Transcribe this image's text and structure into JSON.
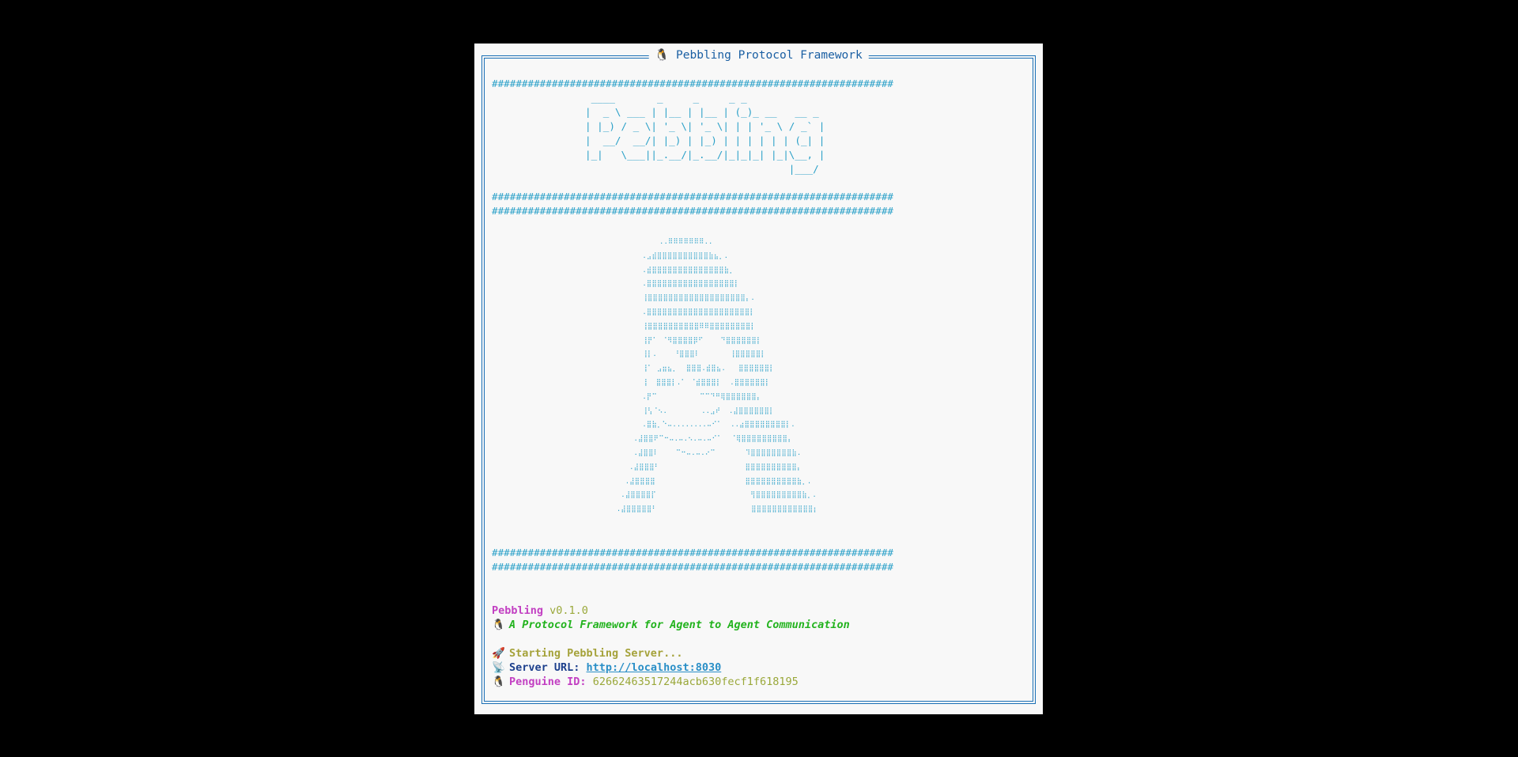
{
  "window": {
    "title": "🐧 Pebbling Protocol Framework"
  },
  "banner": {
    "hash_line": "###################################################################",
    "ascii_text": " ____       _     _     _ _\n|  _ \\ ___ | |__ | |__ | (_)_ __   __ _\n| |_) / _ \\| '_ \\| '_ \\| | | '_ \\ / _` |\n|  __/  __/| |_) | |_) | | | | | | (_| |\n|_|   \\___||_.__/|_.__/|_|_|_| |_|\\__, |\n                                  |___/"
  },
  "penguin": {
    "ascii_art": "          ..⠿⠿⠿⠿⠿⠿⠿..\n      .⣠⣾⣿⣿⣿⣿⣿⣿⣿⣿⣿⣿⣷⣦⡀.\n      .⣾⣿⣿⣿⣿⣿⣿⣿⣿⣿⣿⣿⣿⣿⣿⣷⡀\n      .⣿⣿⣿⣿⣿⣿⣿⣿⣿⣿⣿⣿⣿⣿⣿⣿⣿⡇\n      ⢸⣿⣿⣿⣿⣿⣿⣿⣿⣿⣿⣿⣿⣿⣿⣿⣿⣿⣿⣿⡄.\n      .⣿⣿⣿⣿⣿⣿⣿⣿⣿⣿⣿⣿⣿⣿⣿⣿⣿⣿⣿⣿⡇\n      ⢸⣿⣿⣿⣿⣿⣿⣿⣿⣿⣿⠿⠿⣿⣿⣿⣿⣿⣿⣿⣿⡇\n      ⢸⡟⠁ ⠈⠻⣿⣿⣿⣿⡿⠋    ⠙⣿⣿⣿⣿⣿⣿⡇\n      ⢸⡇.    ⠘⣿⣿⣿⠇       ⢸⣿⣿⣿⣿⣿⡇\n      ⢸⠁ ⣠⣶⣦⡀  ⣿⣿⣿.⣾⣿⣦.   ⣿⣿⣿⣿⣿⣿⡇\n      ⢸  ⣿⣿⣿⡇.⠁ ⠈⣾⣿⣿⣿⡇  .⣿⣿⣿⣿⣿⣿⡇\n      .⡟⠉          ⠉⠉⠙⠛⢿⣿⣿⣿⣿⣿⣿⡄\n      ⢸⢣⠈⠢.        ..⣠⠞  .⣼⣿⣿⣿⣿⣿⣿⡇\n      .⣿⣷⡀⠑⠤........⠤⠊⠁  ..⣴⣿⣿⣿⣿⣿⣿⣿⣿⡇.\n    .⣼⣿⣿⠟⠉⠒⠤.⠤.⠢.⠤.⠤⠊⠁  ⠈⢿⣿⣿⣿⣿⣿⣿⣿⣿⣿⡄\n    .⣼⣿⣿⠇    ⠉⠒⠤.⠤.⠔⠉       ⠹⣿⣿⣿⣿⣿⣿⣿⣿⣷.\n   .⣼⣿⣿⣿⠃                    ⣿⣿⣿⣿⣿⣿⣿⣿⣿⣿⡄\n  .⣼⣿⣿⣿⣿                     ⣿⣿⣿⣿⣿⣿⣿⣿⣿⣿⣷⡀.\n .⣼⣿⣿⣿⣿⡏                      ⢻⣿⣿⣿⣿⣿⣿⣿⣿⣿⣷⡀.\n.⣼⣿⣿⣿⣿⣿⠃                      ⣿⣿⣿⣿⣿⣿⣿⣿⣿⣿⣿⣿⡆"
  },
  "info": {
    "app_name": "Pebbling",
    "version": "v0.1.0",
    "tagline_icon": "🐧",
    "tagline": "A Protocol Framework for Agent to Agent Communication",
    "starting_icon": "🚀",
    "starting_text": "Starting Pebbling Server...",
    "url_icon": "📡",
    "url_label": "Server URL:",
    "url_value": "http://localhost:8030",
    "id_icon": "🐧",
    "id_label": "Penguine ID:",
    "id_value": "62662463517244acb630fecf1f618195"
  },
  "colors": {
    "background": "#000000",
    "panel": "#f8f8f8",
    "frame": "#1a6fb5",
    "ascii": "#2aa0c8",
    "magenta": "#c23fc2",
    "green": "#23b31e",
    "olive": "#a5a23a",
    "navy": "#1c3f8c",
    "link": "#2a8fc7"
  }
}
